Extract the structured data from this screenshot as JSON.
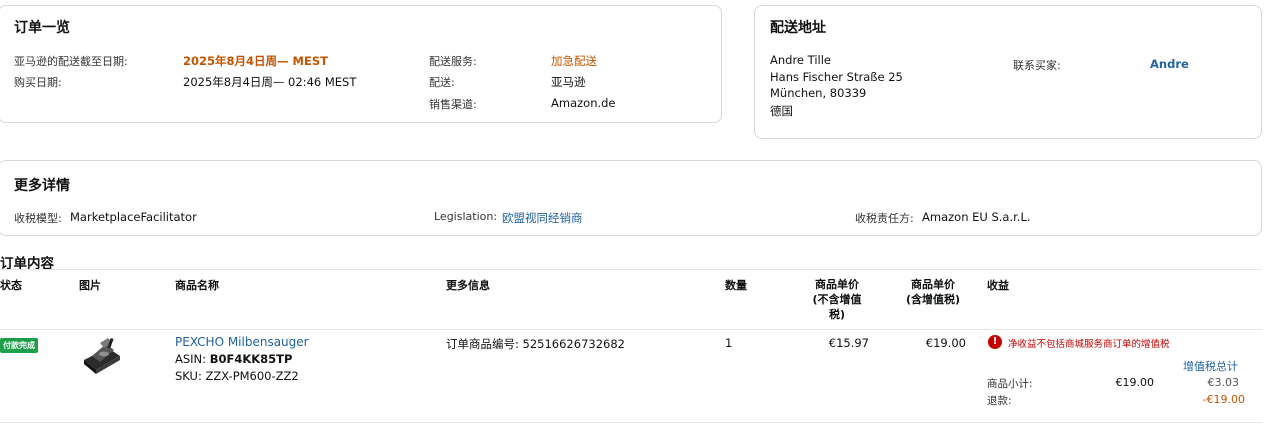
{
  "order_summary": {
    "title": "订单一览",
    "ship_by_label": "亚马逊的配送截至日期:",
    "ship_by_value": "2025年8月4日周— MEST",
    "purchase_date_label": "购买日期:",
    "purchase_date_value": "2025年8月4日周— 02:46 MEST",
    "shipping_service_label": "配送服务:",
    "shipping_service_value": "加急配送",
    "fulfillment_label": "配送:",
    "fulfillment_value": "亚马逊",
    "sales_channel_label": "销售渠道:",
    "sales_channel_value": "Amazon.de"
  },
  "shipping_address": {
    "title": "配送地址",
    "name": "Andre Tille",
    "street": "Hans Fischer Straße 25",
    "city": "München, 80339",
    "country": "德国",
    "contact_label": "联系买家:",
    "contact_value": "Andre"
  },
  "more_details": {
    "title": "更多详情",
    "tax_model_label": "收税模型:",
    "tax_model_value": "MarketplaceFacilitator",
    "legislation_label": "Legislation:",
    "legislation_value": "欧盟视同经销商",
    "tax_party_label": "收税责任方:",
    "tax_party_value": "Amazon EU S.a.r.L."
  },
  "order_contents": {
    "title": "订单内容",
    "headers": {
      "status": "状态",
      "image": "图片",
      "product_name": "商品名称",
      "more_info": "更多信息",
      "quantity": "数量",
      "unit_price_ex_line1": "商品单价",
      "unit_price_ex_line2": "(不含增值",
      "unit_price_ex_line3": "税)",
      "unit_price_inc_line1": "商品单价",
      "unit_price_inc_line2": "(含增值税)",
      "revenue": "收益"
    },
    "row": {
      "status_badge": "付款完成",
      "product_name": "PEXCHO Milbensauger",
      "asin_label": "ASIN:",
      "asin_value": "B0F4KK85TP",
      "sku_label": "SKU:",
      "sku_value": "ZZX-PM600-ZZ2",
      "order_item_label": "订单商品编号:",
      "order_item_value": "52516626732682",
      "quantity": "1",
      "unit_price_ex": "€15.97",
      "unit_price_inc": "€19.00",
      "revenue_note": "净收益不包括商城服务商订单的增值税",
      "vat_total_label": "增值税总计",
      "subtotal_label": "商品小计:",
      "subtotal_value": "€19.00",
      "subtotal_vat": "€3.03",
      "refund_label": "退款:",
      "refund_vat": "-€19.00"
    }
  },
  "colors": {
    "orange_accent": "#c45500",
    "link_blue": "#2162a1",
    "badge_green": "#1e9e4a",
    "warning_red": "#c40000",
    "border": "#d5d9d9"
  }
}
